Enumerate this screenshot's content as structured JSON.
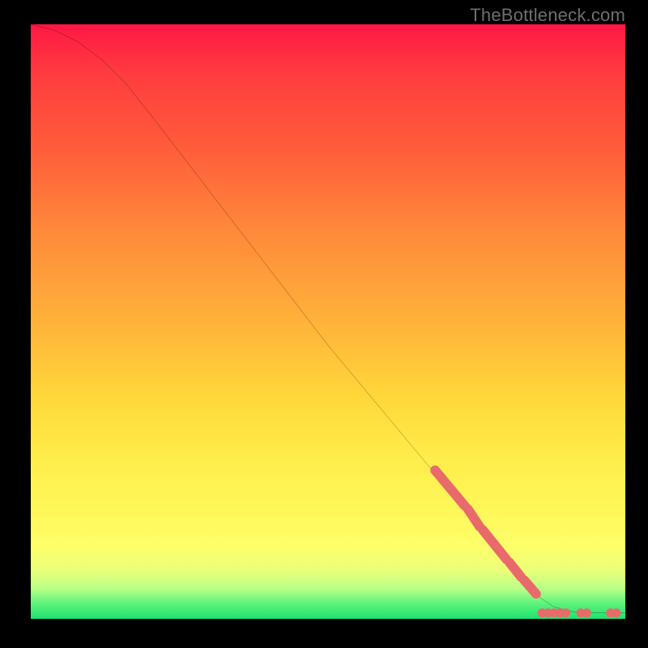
{
  "attribution": "TheBottleneck.com",
  "chart_data": {
    "type": "line",
    "title": "",
    "xlabel": "",
    "ylabel": "",
    "xlim": [
      0,
      100
    ],
    "ylim": [
      0,
      100
    ],
    "grid": false,
    "legend": false,
    "curve": [
      {
        "x": 0,
        "y": 100
      },
      {
        "x": 4,
        "y": 99
      },
      {
        "x": 8,
        "y": 97
      },
      {
        "x": 12,
        "y": 94
      },
      {
        "x": 16,
        "y": 90
      },
      {
        "x": 20,
        "y": 85
      },
      {
        "x": 30,
        "y": 72
      },
      {
        "x": 40,
        "y": 59
      },
      {
        "x": 50,
        "y": 46
      },
      {
        "x": 60,
        "y": 34
      },
      {
        "x": 70,
        "y": 22
      },
      {
        "x": 78,
        "y": 12
      },
      {
        "x": 82,
        "y": 7
      },
      {
        "x": 85,
        "y": 4
      },
      {
        "x": 88,
        "y": 2
      },
      {
        "x": 92,
        "y": 1
      },
      {
        "x": 100,
        "y": 1
      }
    ],
    "highlight_segments": [
      {
        "x1": 68,
        "y1": 25,
        "x2": 73,
        "y2": 19
      },
      {
        "x1": 73.5,
        "y1": 18.5,
        "x2": 75.5,
        "y2": 15.5
      },
      {
        "x1": 76,
        "y1": 15,
        "x2": 80,
        "y2": 10
      },
      {
        "x1": 80.5,
        "y1": 9.5,
        "x2": 82.5,
        "y2": 7
      },
      {
        "x1": 83,
        "y1": 6.5,
        "x2": 85,
        "y2": 4.2
      }
    ],
    "highlight_dots": [
      {
        "x": 86,
        "y": 1
      },
      {
        "x": 87,
        "y": 1
      },
      {
        "x": 88,
        "y": 1
      },
      {
        "x": 89,
        "y": 1
      },
      {
        "x": 90,
        "y": 1
      },
      {
        "x": 92.5,
        "y": 1
      },
      {
        "x": 93.5,
        "y": 1
      },
      {
        "x": 97.5,
        "y": 1
      },
      {
        "x": 98.5,
        "y": 1
      }
    ],
    "highlight_color": "#e96a6a",
    "curve_color": "#000000"
  }
}
